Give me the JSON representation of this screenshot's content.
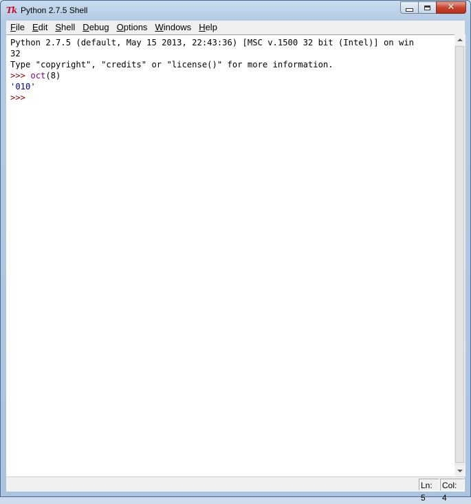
{
  "window": {
    "title": "Python 2.7.5 Shell",
    "app_icon": "tk-icon",
    "app_icon_glyph": "Tk"
  },
  "menu": {
    "items": [
      {
        "label": "File",
        "mnemonic": "F",
        "rest": "ile"
      },
      {
        "label": "Edit",
        "mnemonic": "E",
        "rest": "dit"
      },
      {
        "label": "Shell",
        "mnemonic": "S",
        "rest": "hell",
        "pre": ""
      },
      {
        "label": "Debug",
        "mnemonic": "D",
        "rest": "ebug"
      },
      {
        "label": "Options",
        "mnemonic": "O",
        "rest": "ptions"
      },
      {
        "label": "Windows",
        "mnemonic": "W",
        "rest": "indows"
      },
      {
        "label": "Help",
        "mnemonic": "H",
        "rest": "elp"
      }
    ]
  },
  "shell": {
    "line1": "Python 2.7.5 (default, May 15 2013, 22:43:36) [MSC v.1500 32 bit (Intel)] on win",
    "line2": "32",
    "line3": "Type \"copyright\", \"credits\" or \"license()\" for more information.",
    "prompt1": ">>> ",
    "command_func": "oct",
    "command_args": "(8)",
    "result": "'010'",
    "prompt2": ">>>"
  },
  "status": {
    "ln": "Ln: 5",
    "col": "Col: 4"
  },
  "colors": {
    "prompt": "#8b0000",
    "builtin": "#8b008b",
    "string": "#00008b"
  }
}
